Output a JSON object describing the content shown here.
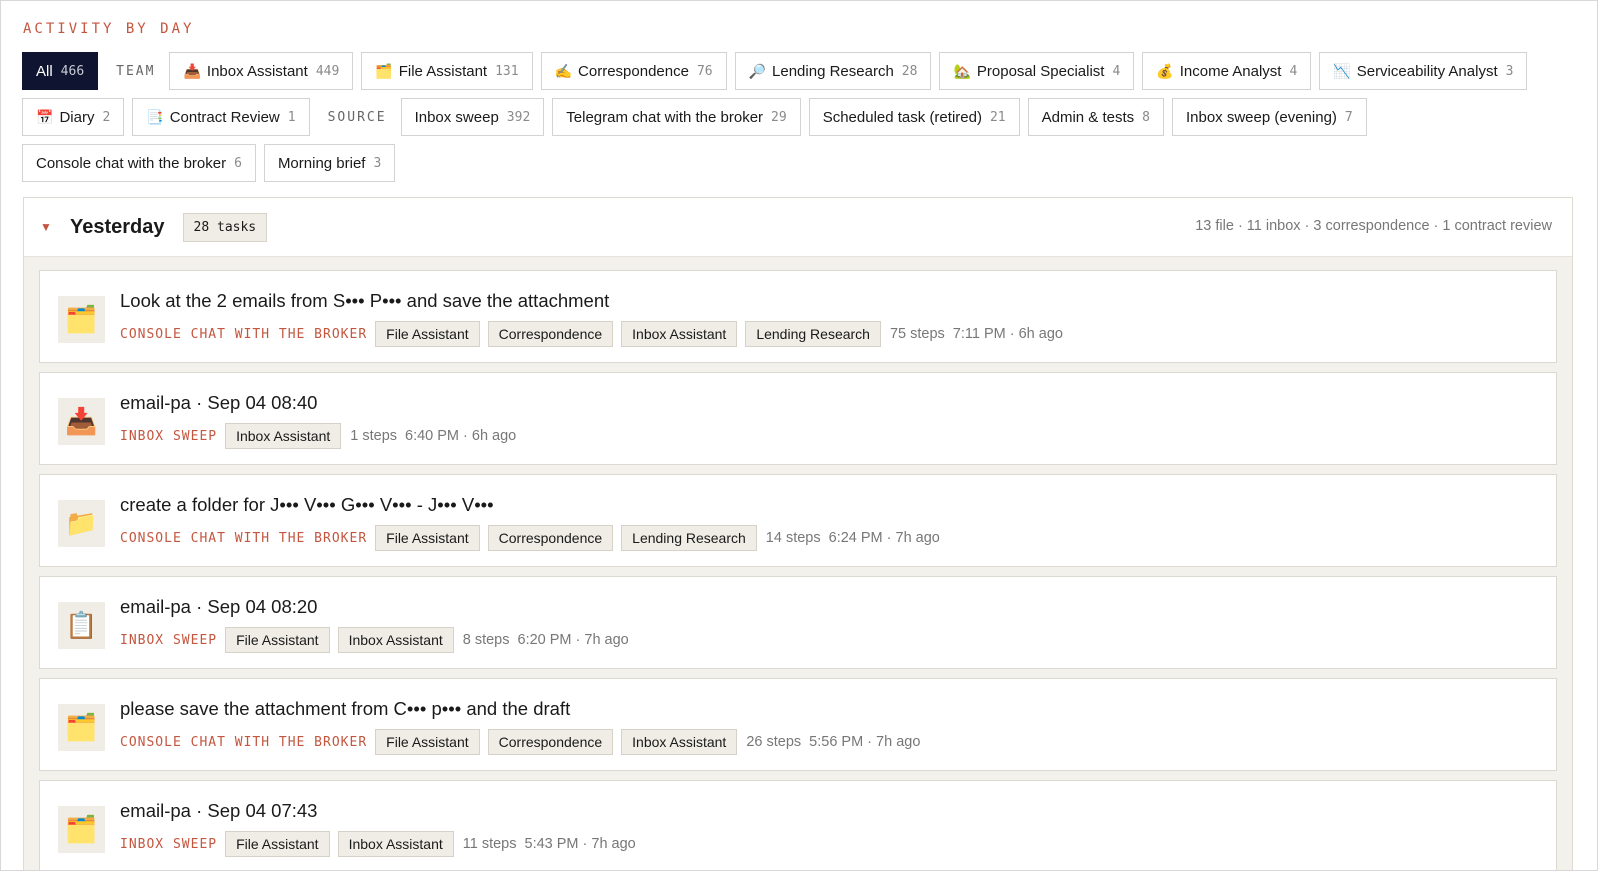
{
  "section_title": "ACTIVITY BY DAY",
  "filters": {
    "team_label": "TEAM",
    "source_label": "SOURCE",
    "all": {
      "label": "All",
      "count": "466"
    },
    "team": [
      {
        "icon": "📥",
        "label": "Inbox Assistant",
        "count": "449"
      },
      {
        "icon": "🗂️",
        "label": "File Assistant",
        "count": "131"
      },
      {
        "icon": "✍️",
        "label": "Correspondence",
        "count": "76"
      },
      {
        "icon": "🔎",
        "label": "Lending Research",
        "count": "28"
      },
      {
        "icon": "🏡",
        "label": "Proposal Specialist",
        "count": "4"
      },
      {
        "icon": "💰",
        "label": "Income Analyst",
        "count": "4"
      },
      {
        "icon": "📉",
        "label": "Serviceability Analyst",
        "count": "3"
      },
      {
        "icon": "📅",
        "label": "Diary",
        "count": "2"
      },
      {
        "icon": "📑",
        "label": "Contract Review",
        "count": "1"
      }
    ],
    "source": [
      {
        "label": "Inbox sweep",
        "count": "392"
      },
      {
        "label": "Telegram chat with the broker",
        "count": "29"
      },
      {
        "label": "Scheduled task (retired)",
        "count": "21"
      },
      {
        "label": "Admin & tests",
        "count": "8"
      },
      {
        "label": "Inbox sweep (evening)",
        "count": "7"
      },
      {
        "label": "Console chat with the broker",
        "count": "6"
      },
      {
        "label": "Morning brief",
        "count": "3"
      }
    ]
  },
  "day": {
    "caret": "▼",
    "title": "Yesterday",
    "task_count": "28 tasks",
    "summary": "13 file · 11 inbox · 3 correspondence · 1 contract review"
  },
  "tasks": [
    {
      "icon": "🗂️",
      "title": "Look at the 2 emails from S••• P••• and save the attachment",
      "source": "CONSOLE CHAT WITH THE BROKER",
      "tags": [
        "File Assistant",
        "Correspondence",
        "Inbox Assistant",
        "Lending Research"
      ],
      "steps": "75 steps",
      "time": "7:11 PM · 6h ago"
    },
    {
      "icon": "📥",
      "title": "email-pa · Sep 04 08:40",
      "source": "INBOX SWEEP",
      "tags": [
        "Inbox Assistant"
      ],
      "steps": "1 steps",
      "time": "6:40 PM · 6h ago"
    },
    {
      "icon": "📁",
      "title": "create a folder for J••• V••• G••• V••• - J••• V•••",
      "source": "CONSOLE CHAT WITH THE BROKER",
      "tags": [
        "File Assistant",
        "Correspondence",
        "Lending Research"
      ],
      "steps": "14 steps",
      "time": "6:24 PM · 7h ago"
    },
    {
      "icon": "📋",
      "title": "email-pa · Sep 04 08:20",
      "source": "INBOX SWEEP",
      "tags": [
        "File Assistant",
        "Inbox Assistant"
      ],
      "steps": "8 steps",
      "time": "6:20 PM · 7h ago"
    },
    {
      "icon": "🗂️",
      "title": "please save the attachment from C••• p••• and the draft",
      "source": "CONSOLE CHAT WITH THE BROKER",
      "tags": [
        "File Assistant",
        "Correspondence",
        "Inbox Assistant"
      ],
      "steps": "26 steps",
      "time": "5:56 PM · 7h ago"
    },
    {
      "icon": "🗂️",
      "title": "email-pa · Sep 04 07:43",
      "source": "INBOX SWEEP",
      "tags": [
        "File Assistant",
        "Inbox Assistant"
      ],
      "steps": "11 steps",
      "time": "5:43 PM · 7h ago"
    }
  ]
}
